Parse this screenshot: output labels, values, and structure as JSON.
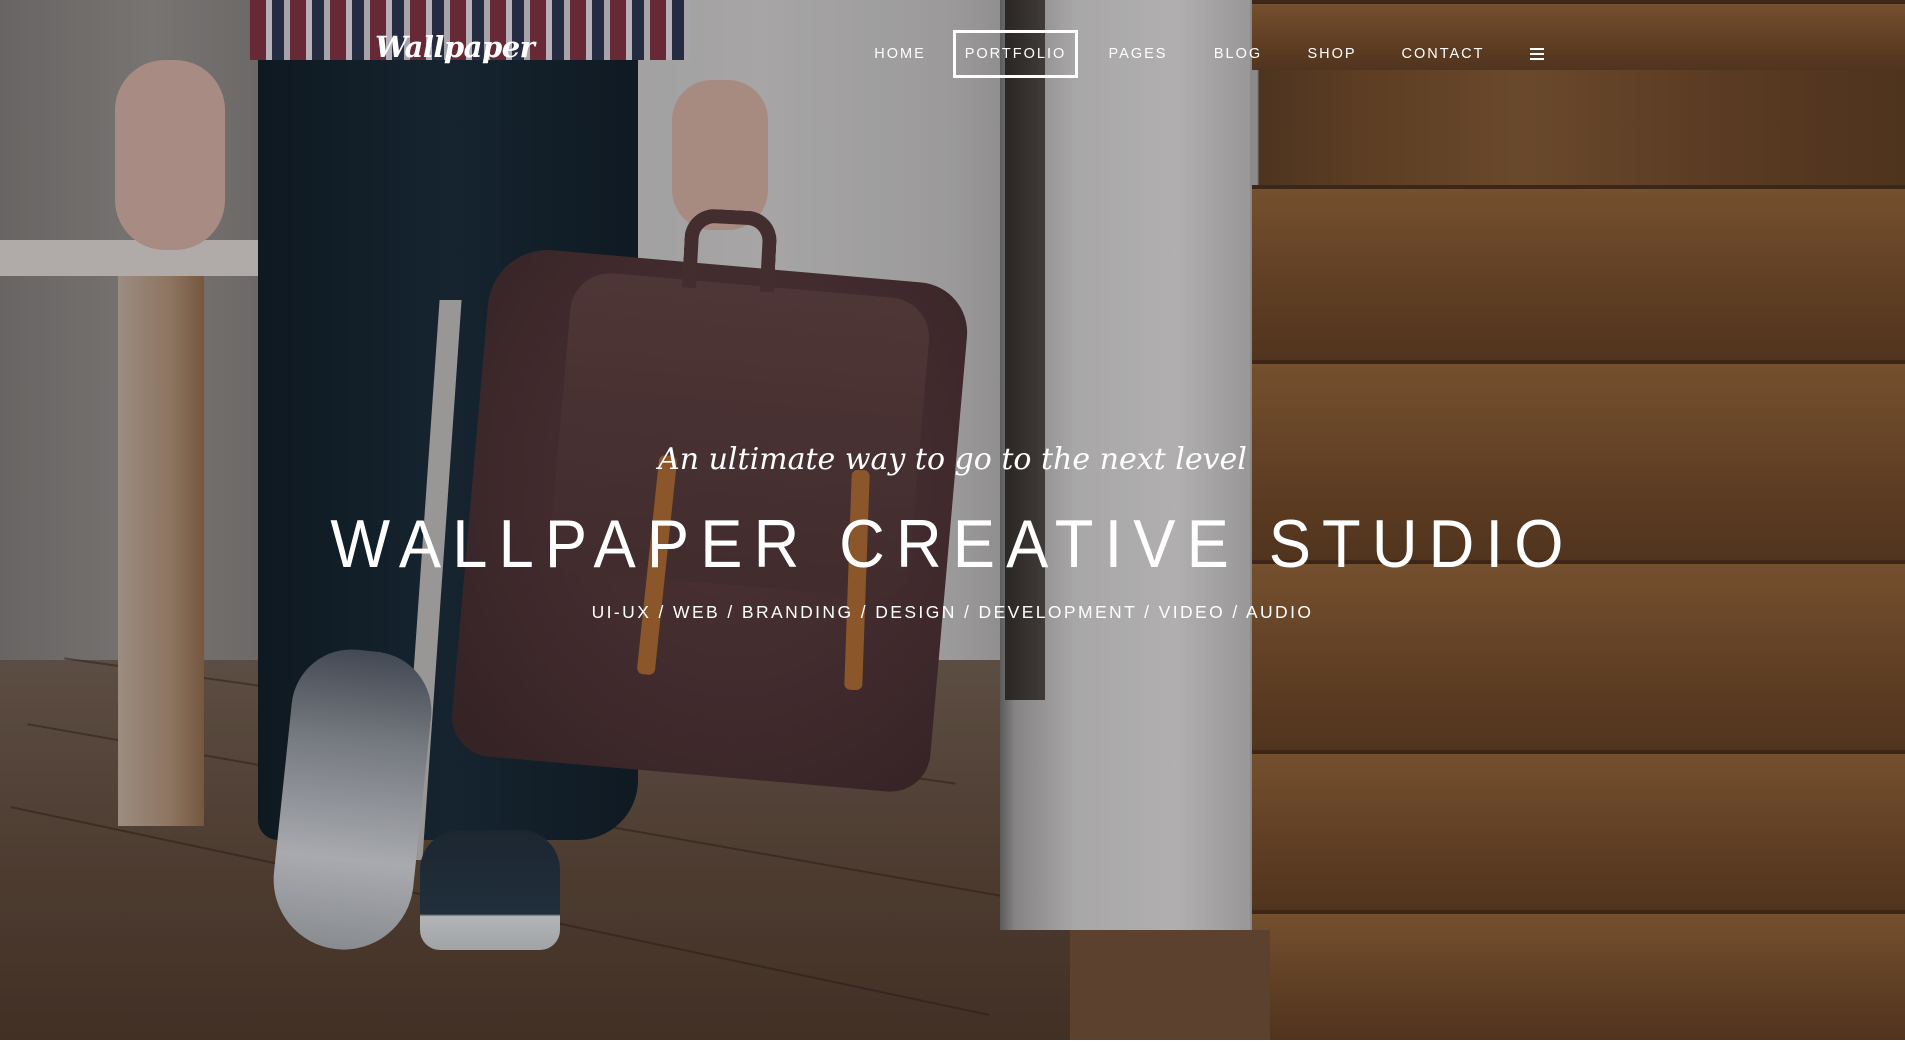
{
  "brand": {
    "logo_text": "Wallpaper"
  },
  "nav": {
    "items": [
      {
        "label": "HOME",
        "active": false
      },
      {
        "label": "PORTFOLIO",
        "active": true
      },
      {
        "label": "PAGES",
        "active": false
      },
      {
        "label": "BLOG",
        "active": false
      },
      {
        "label": "SHOP",
        "active": false
      },
      {
        "label": "CONTACT",
        "active": false
      }
    ],
    "menu_icon": "hamburger-menu-icon"
  },
  "hero": {
    "tagline": "An ultimate way to go to the next level",
    "headline": "WALLPAPER CREATIVE STUDIO",
    "services": "UI-UX / WEB / BRANDING / DESIGN / DEVELOPMENT / VIDEO / AUDIO"
  },
  "colors": {
    "text": "#ffffff",
    "stair_wood": "#7d5430",
    "jeans": "#162835",
    "backpack": "#4a2f31"
  }
}
